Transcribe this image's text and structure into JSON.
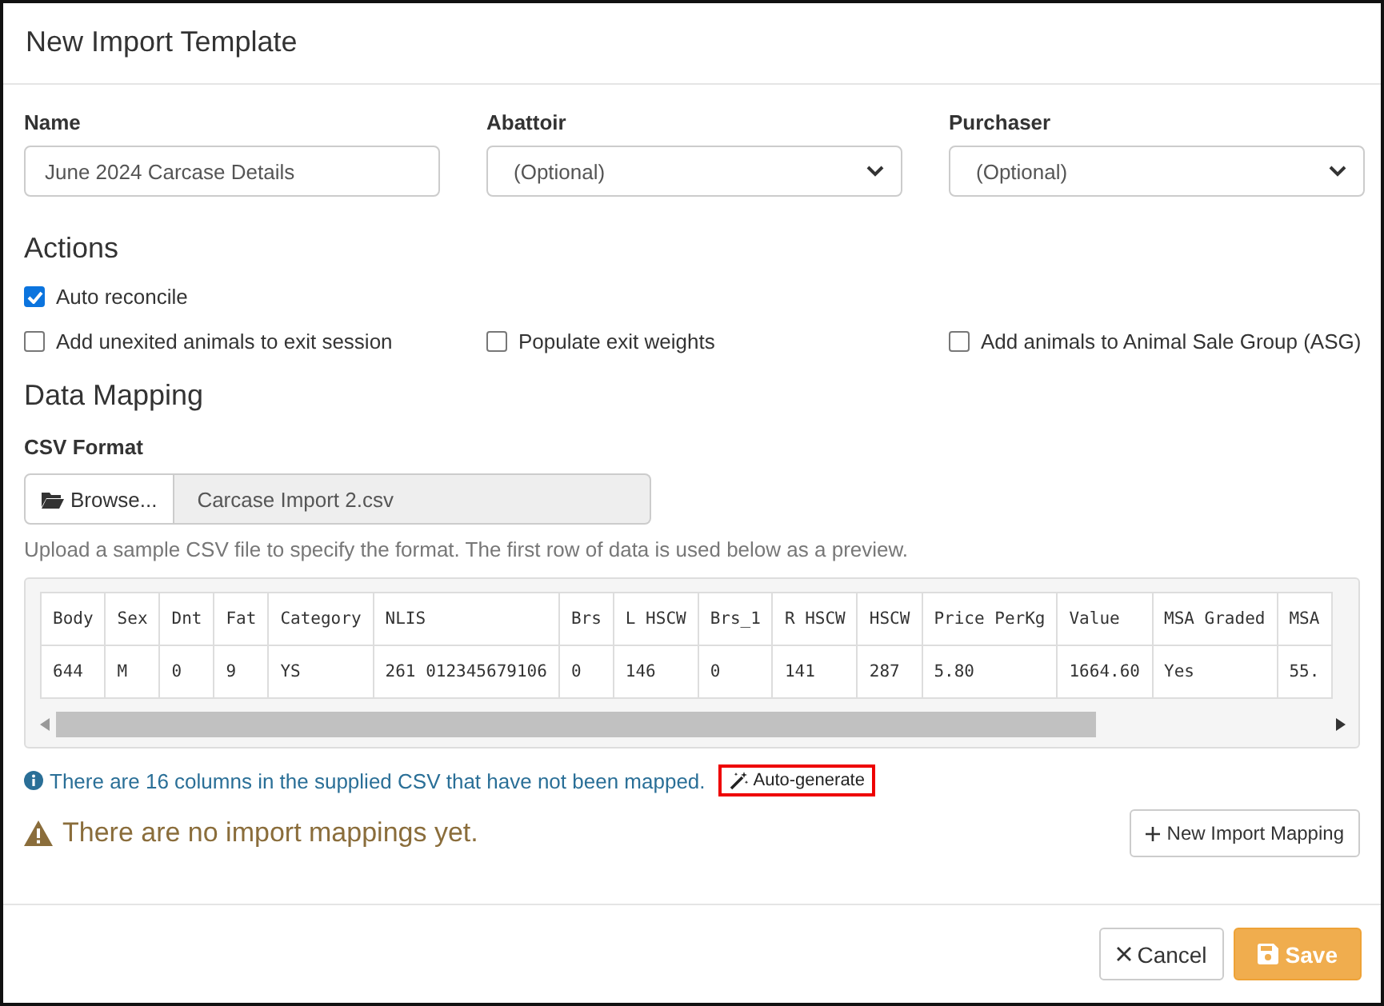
{
  "window": {
    "title": "New Import Template"
  },
  "fields": [
    {
      "kind": "text",
      "label": "Name",
      "value": "June 2024 Carcase Details"
    },
    {
      "kind": "select",
      "label": "Abattoir",
      "value": "(Optional)"
    },
    {
      "kind": "select",
      "label": "Purchaser",
      "value": "(Optional)"
    }
  ],
  "actions": {
    "title": "Actions",
    "rows": [
      [
        {
          "label": "Auto reconcile",
          "checked": true
        }
      ],
      [
        {
          "label": "Add unexited animals to exit session",
          "checked": false
        },
        {
          "label": "Populate exit weights",
          "checked": false
        },
        {
          "label": "Add animals to Animal Sale Group (ASG)",
          "checked": false
        }
      ]
    ]
  },
  "data_mapping": {
    "title": "Data Mapping",
    "csv_label": "CSV Format",
    "browse_button": "Browse...",
    "file_name": "Carcase Import 2.csv",
    "help": "Upload a sample CSV file to specify the format. The first row of data is used below as a preview.",
    "preview": {
      "columns": [
        "Body",
        "Sex",
        "Dnt",
        "Fat",
        "Category",
        "NLIS",
        "Brs",
        "L HSCW",
        "Brs_1",
        "R HSCW",
        "HSCW",
        "Price PerKg",
        "Value",
        "MSA Graded",
        "MSA"
      ],
      "rows": [
        [
          "644",
          "M",
          "0",
          "9",
          "YS",
          "261 012345679106",
          "0",
          "146",
          "0",
          "141",
          "287",
          "5.80",
          "1664.60",
          "Yes",
          "55."
        ]
      ]
    },
    "unmapped_info": "There are 16 columns in the supplied CSV that have not been mapped.",
    "auto_generate": {
      "label": "Auto-generate",
      "highlighted": true
    },
    "warning": "There are no import mappings yet.",
    "new_mapping_button": "New Import Mapping"
  },
  "buttons": [
    {
      "kind": "cancel",
      "label": "Cancel"
    },
    {
      "kind": "save",
      "label": "Save"
    }
  ]
}
